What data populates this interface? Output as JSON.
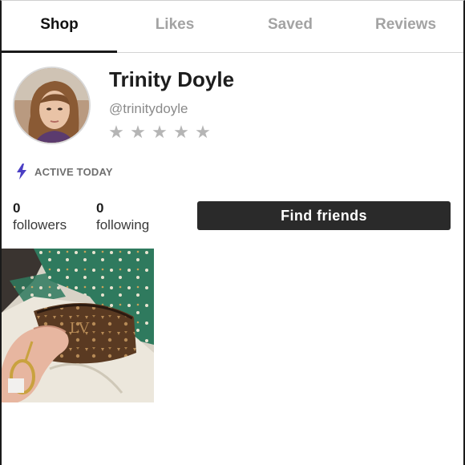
{
  "tabs": [
    {
      "label": "Shop",
      "active": true
    },
    {
      "label": "Likes",
      "active": false
    },
    {
      "label": "Saved",
      "active": false
    },
    {
      "label": "Reviews",
      "active": false
    }
  ],
  "profile": {
    "name": "Trinity Doyle",
    "handle": "@trinitydoyle",
    "rating_stars": 0,
    "stars_total": 5,
    "avatar_icon": "user-photo",
    "active_status": "ACTIVE TODAY",
    "active_icon": "lightning-bolt-icon"
  },
  "stats": {
    "followers_count": "0",
    "followers_label": "followers",
    "following_count": "0",
    "following_label": "following"
  },
  "actions": {
    "find_friends_label": "Find friends"
  },
  "listings": [
    {
      "image": "wallet-photo"
    }
  ],
  "colors": {
    "accent_bolt": "#4b3fc4",
    "button_bg": "#2a2a2a",
    "star_empty": "#b5b5b5",
    "tab_inactive": "#a3a3a3"
  }
}
